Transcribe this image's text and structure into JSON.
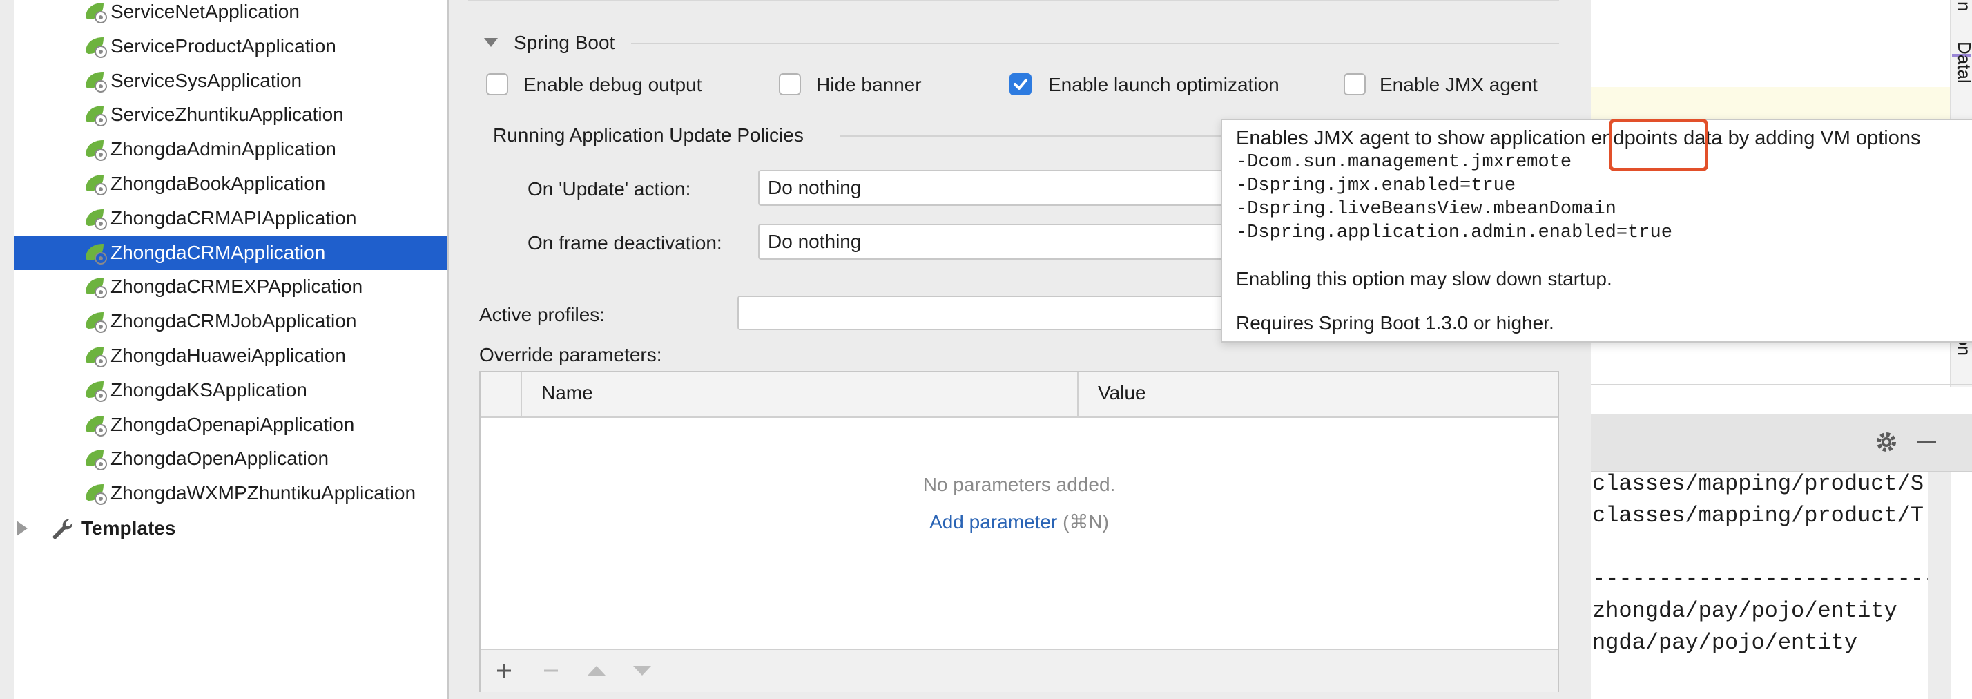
{
  "sidebar": {
    "apps": [
      {
        "label": "ServiceNetApplication",
        "selected": false
      },
      {
        "label": "ServiceProductApplication",
        "selected": false
      },
      {
        "label": "ServiceSysApplication",
        "selected": false
      },
      {
        "label": "ServiceZhuntikuApplication",
        "selected": false
      },
      {
        "label": "ZhongdaAdminApplication",
        "selected": false
      },
      {
        "label": "ZhongdaBookApplication",
        "selected": false
      },
      {
        "label": "ZhongdaCRMAPIApplication",
        "selected": false
      },
      {
        "label": "ZhongdaCRMApplication",
        "selected": true
      },
      {
        "label": "ZhongdaCRMEXPApplication",
        "selected": false
      },
      {
        "label": "ZhongdaCRMJobApplication",
        "selected": false
      },
      {
        "label": "ZhongdaHuaweiApplication",
        "selected": false
      },
      {
        "label": "ZhongdaKSApplication",
        "selected": false
      },
      {
        "label": "ZhongdaOpenapiApplication",
        "selected": false
      },
      {
        "label": "ZhongdaOpenApplication",
        "selected": false
      },
      {
        "label": "ZhongdaWXMPZhuntikuApplication",
        "selected": false
      }
    ],
    "templates_label": "Templates"
  },
  "spring_boot": {
    "title": "Spring Boot",
    "options": {
      "debug": {
        "label": "Enable debug output",
        "checked": false
      },
      "banner": {
        "label": "Hide banner",
        "checked": false
      },
      "launch": {
        "label": "Enable launch optimization",
        "checked": true
      },
      "jmx": {
        "label": "Enable JMX agent",
        "checked": false
      }
    }
  },
  "update_policies": {
    "title": "Running Application Update Policies",
    "on_update_label": "On 'Update' action:",
    "on_update_value": "Do nothing",
    "on_deactivation_label": "On frame deactivation:",
    "on_deactivation_value": "Do nothing"
  },
  "active_profiles_label": "Active profiles:",
  "override": {
    "label": "Override parameters:",
    "col_name": "Name",
    "col_value": "Value",
    "empty_text": "No parameters added.",
    "add_link": "Add parameter",
    "add_shortcut": "(⌘N)"
  },
  "tooltip": {
    "line1_pre": "Enables JMX agent to show application ",
    "line1_hl": "endpoints",
    "line1_post": " data by adding VM options",
    "opt1": "-Dcom.sun.management.jmxremote",
    "opt2": "-Dspring.jmx.enabled=true",
    "opt3": "-Dspring.liveBeansView.mbeanDomain",
    "opt4": "-Dspring.application.admin.enabled=true",
    "note1": "Enabling this option may slow down startup.",
    "note2": "Requires Spring Boot 1.3.0 or higher."
  },
  "right_panel": {
    "code_lines": [
      "classes/mapping/product/S",
      "classes/mapping/product/T",
      "--------------------------",
      "zhongda/pay/pojo/entity",
      "ngda/pay/pojo/entity"
    ],
    "vertical_top": "n",
    "vertical_mid": "Datal",
    "vertical_bottom": "on"
  },
  "colors": {
    "accent": "#1f5fcc",
    "highlight": "#e2502a",
    "checkbox": "#2d7be0",
    "link": "#2a64b5"
  }
}
